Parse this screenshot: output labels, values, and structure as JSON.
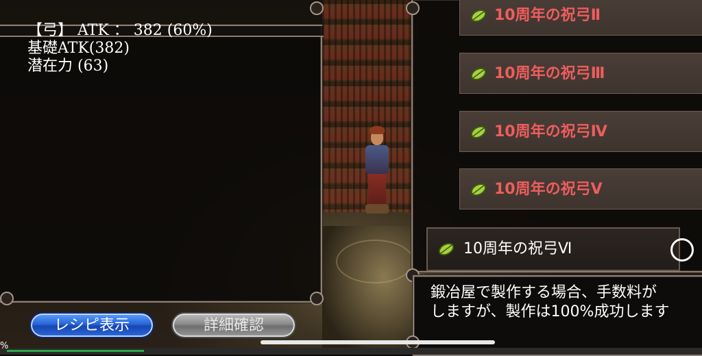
{
  "info": {
    "line1": "【弓】 ATK ： 382 (60%)",
    "line2": "基礎ATK(382)",
    "line3": "潜在力 (63)"
  },
  "recipes": [
    {
      "label": "10周年の祝弓Ⅱ",
      "icon": "leaf-icon",
      "selected": false
    },
    {
      "label": "10周年の祝弓Ⅲ",
      "icon": "leaf-icon",
      "selected": false
    },
    {
      "label": "10周年の祝弓Ⅳ",
      "icon": "leaf-icon",
      "selected": false
    },
    {
      "label": "10周年の祝弓Ⅴ",
      "icon": "leaf-icon",
      "selected": false
    },
    {
      "label": "10周年の祝弓Ⅵ",
      "icon": "leaf-icon",
      "selected": true
    }
  ],
  "description": {
    "line1": "鍛冶屋で製作する場合、手数料が",
    "line2": "しますが、製作は100%成功します"
  },
  "buttons": {
    "recipe": "レシピ表示",
    "detail": "詳細確認"
  },
  "status": {
    "pct": "%"
  },
  "colors": {
    "recipe_label": "#ef5d5d",
    "selected_label": "#ffffff",
    "recipe_button": "#2a66d8",
    "detail_button": "#8a8a8a"
  }
}
